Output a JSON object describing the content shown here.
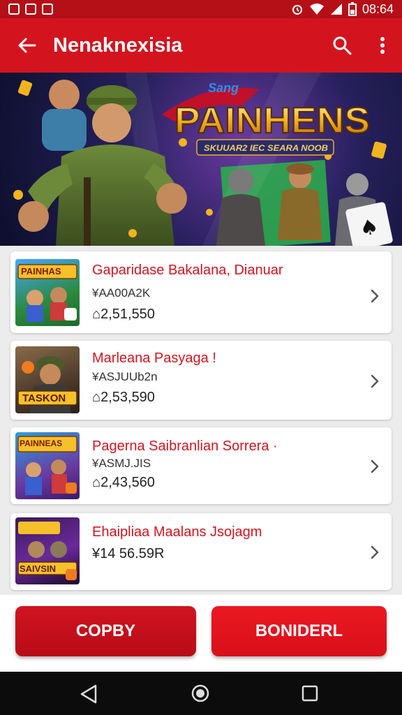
{
  "status": {
    "time": "08:64"
  },
  "appbar": {
    "title": "Nenaknexisia",
    "back_icon": "arrow-left-icon",
    "search_icon": "search-icon",
    "menu_icon": "more-vert-icon"
  },
  "banner": {
    "logo_top": "Sang",
    "logo_main": "PAINHENS",
    "logo_sub": "SKUUAR2 IEC SEARA NOOB"
  },
  "list": [
    {
      "title": "Gaparidase Bakalana, Dianuar",
      "subtitle": "¥AA00A2K",
      "price": "⌂2,51,550",
      "thumb_text": "PAINHAS"
    },
    {
      "title": "Marleana Pasyaga !",
      "subtitle": "¥ASJUUb2n",
      "price": "⌂2,53,590",
      "thumb_text": "TASKON"
    },
    {
      "title": "Pagerna Saibranlian Sorrera ·",
      "subtitle": "¥ASMJ.JIS",
      "price": "⌂2,43,560",
      "thumb_text": "PAINNEAS"
    },
    {
      "title": "Ehaipliaa Maalans Jsojagm",
      "subtitle": "",
      "price": "¥14 56.59R",
      "thumb_text": "SAIVSIN"
    }
  ],
  "buttons": {
    "left": "COPBY",
    "right": "BONIDERL"
  },
  "colors": {
    "primary": "#d3141e",
    "status": "#b50f17",
    "button_left": "#c80c16",
    "button_right": "#e3111b"
  }
}
